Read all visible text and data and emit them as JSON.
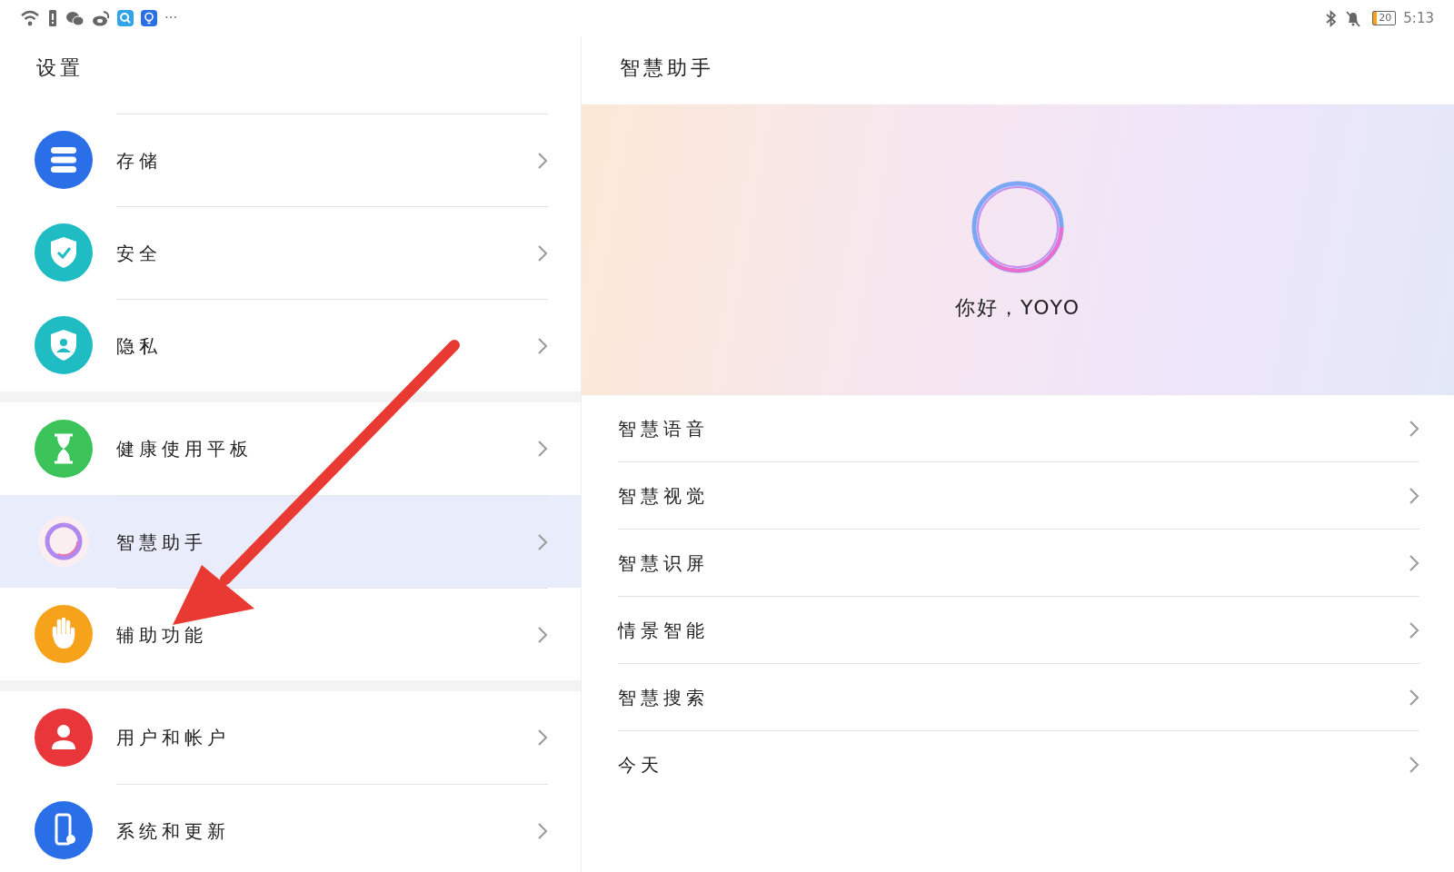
{
  "status_bar": {
    "more": "···",
    "battery": "20",
    "time": "5:13"
  },
  "settings": {
    "title": "设置",
    "groups": [
      {
        "items": [
          {
            "label": "存储",
            "kind": "storage",
            "color": "#2a6ee8",
            "selected": false
          },
          {
            "label": "安全",
            "kind": "shield",
            "color": "#1fbcc4",
            "selected": false
          },
          {
            "label": "隐私",
            "kind": "privacy",
            "color": "#1fbcc4",
            "selected": false
          }
        ]
      },
      {
        "items": [
          {
            "label": "健康使用平板",
            "kind": "hourglass",
            "color": "#3cc45a",
            "selected": false
          },
          {
            "label": "智慧助手",
            "kind": "assistant",
            "color": "#b088f0",
            "selected": true
          },
          {
            "label": "辅助功能",
            "kind": "hand",
            "color": "#f7a21b",
            "selected": false
          }
        ]
      },
      {
        "items": [
          {
            "label": "用户和帐户",
            "kind": "user",
            "color": "#e8363a",
            "selected": false
          },
          {
            "label": "系统和更新",
            "kind": "system",
            "color": "#2a6ee8",
            "selected": false
          }
        ]
      }
    ]
  },
  "assistant": {
    "title": "智慧助手",
    "greeting": "你好，YOYO",
    "items": [
      {
        "label": "智慧语音"
      },
      {
        "label": "智慧视觉"
      },
      {
        "label": "智慧识屏"
      },
      {
        "label": "情景智能"
      },
      {
        "label": "智慧搜索"
      },
      {
        "label": "今天"
      }
    ]
  }
}
